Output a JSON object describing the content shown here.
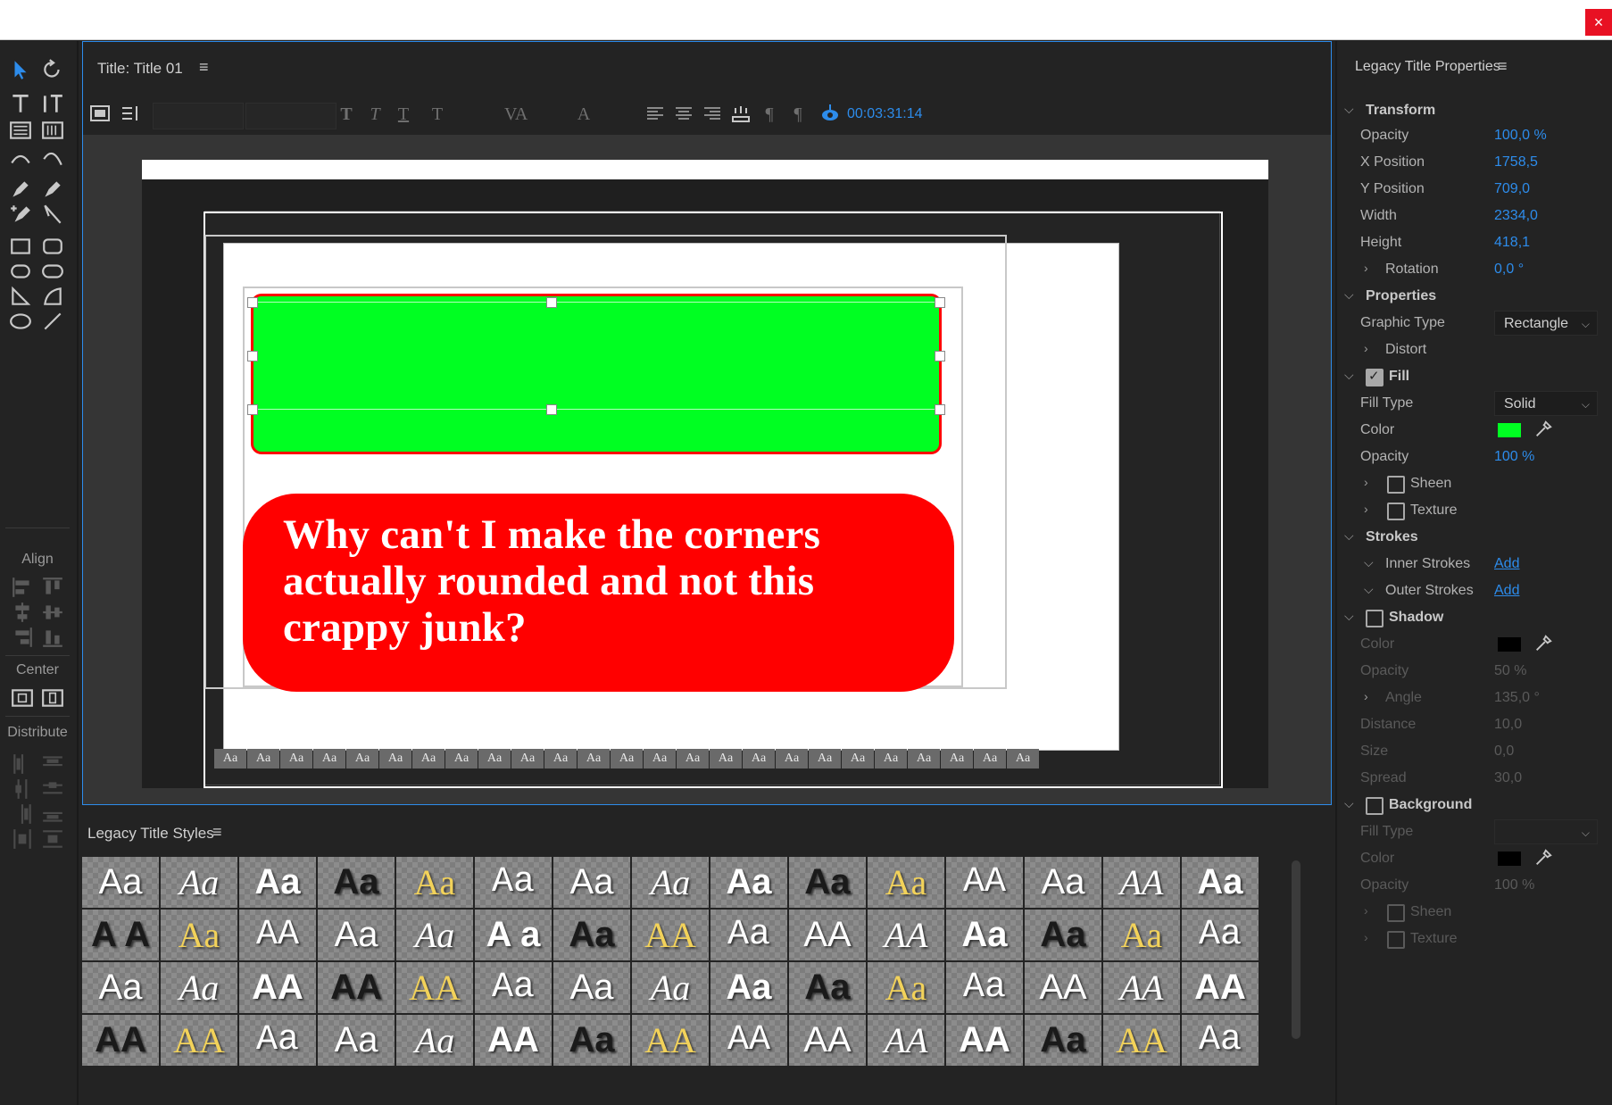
{
  "window": {
    "close_glyph": "×"
  },
  "tools": {
    "align_label": "Align",
    "center_label": "Center",
    "distribute_label": "Distribute"
  },
  "title_panel": {
    "title": "Title: Title 01",
    "menu_glyph": "≡",
    "timecode": "00:03:31:14"
  },
  "canvas": {
    "text_content": "Why can't I make the corners actually rounded and not this crappy junk?",
    "green_fill": "#00ff22",
    "red_fill": "#ff0000"
  },
  "styles_panel": {
    "title": "Legacy Title Styles",
    "menu_glyph": "≡",
    "rows": [
      [
        "Aa",
        "Aa",
        "Aa",
        "Aa",
        "Aa",
        "Aa",
        "Aa",
        "Aa",
        "Aa",
        "Aa",
        "Aa",
        "AA",
        "Aa",
        "AA",
        "Aa"
      ],
      [
        "A A",
        "Aa",
        "AA",
        "Aa",
        "Aa",
        "A a",
        "Aa",
        "AA",
        "Aa",
        "AA",
        "AA",
        "Aa",
        "Aa",
        "Aa",
        "Aa"
      ],
      [
        "Aa",
        "Aa",
        "AA",
        "AA",
        "AA",
        "Aa",
        "Aa",
        "Aa",
        "Aa",
        "Aa",
        "Aa",
        "Aa",
        "AA",
        "AA",
        "AA"
      ],
      [
        "AA",
        "AA",
        "Aa",
        "Aa",
        "Aa",
        "AA",
        "Aa",
        "AA",
        "AA",
        "AA",
        "AA",
        "AA",
        "Aa",
        "AA",
        "Aa"
      ]
    ]
  },
  "properties": {
    "title": "Legacy Title Properties",
    "menu_glyph": "≡",
    "transform": {
      "label": "Transform",
      "opacity_label": "Opacity",
      "opacity": "100,0",
      "opacity_unit": "%",
      "x_label": "X Position",
      "x": "1758,5",
      "y_label": "Y Position",
      "y": "709,0",
      "width_label": "Width",
      "width": "2334,0",
      "height_label": "Height",
      "height": "418,1",
      "rotation_label": "Rotation",
      "rotation": "0,0 °"
    },
    "properties": {
      "label": "Properties",
      "graphic_type_label": "Graphic Type",
      "graphic_type": "Rectangle",
      "distort_label": "Distort"
    },
    "fill": {
      "label": "Fill",
      "fill_type_label": "Fill Type",
      "fill_type": "Solid",
      "color_label": "Color",
      "color": "#00ff22",
      "opacity_label": "Opacity",
      "opacity": "100",
      "opacity_unit": "%",
      "sheen_label": "Sheen",
      "texture_label": "Texture"
    },
    "strokes": {
      "label": "Strokes",
      "inner_label": "Inner Strokes",
      "inner_action": "Add",
      "outer_label": "Outer Strokes",
      "outer_action": "Add"
    },
    "shadow": {
      "label": "Shadow",
      "color_label": "Color",
      "color": "#000000",
      "opacity_label": "Opacity",
      "opacity": "50",
      "opacity_unit": "%",
      "angle_label": "Angle",
      "angle": "135,0 °",
      "distance_label": "Distance",
      "distance": "10,0",
      "size_label": "Size",
      "size": "0,0",
      "spread_label": "Spread",
      "spread": "30,0"
    },
    "background": {
      "label": "Background",
      "fill_type_label": "Fill Type",
      "color_label": "Color",
      "color": "#000000",
      "opacity_label": "Opacity",
      "opacity": "100",
      "opacity_unit": "%",
      "sheen_label": "Sheen",
      "texture_label": "Texture"
    }
  }
}
